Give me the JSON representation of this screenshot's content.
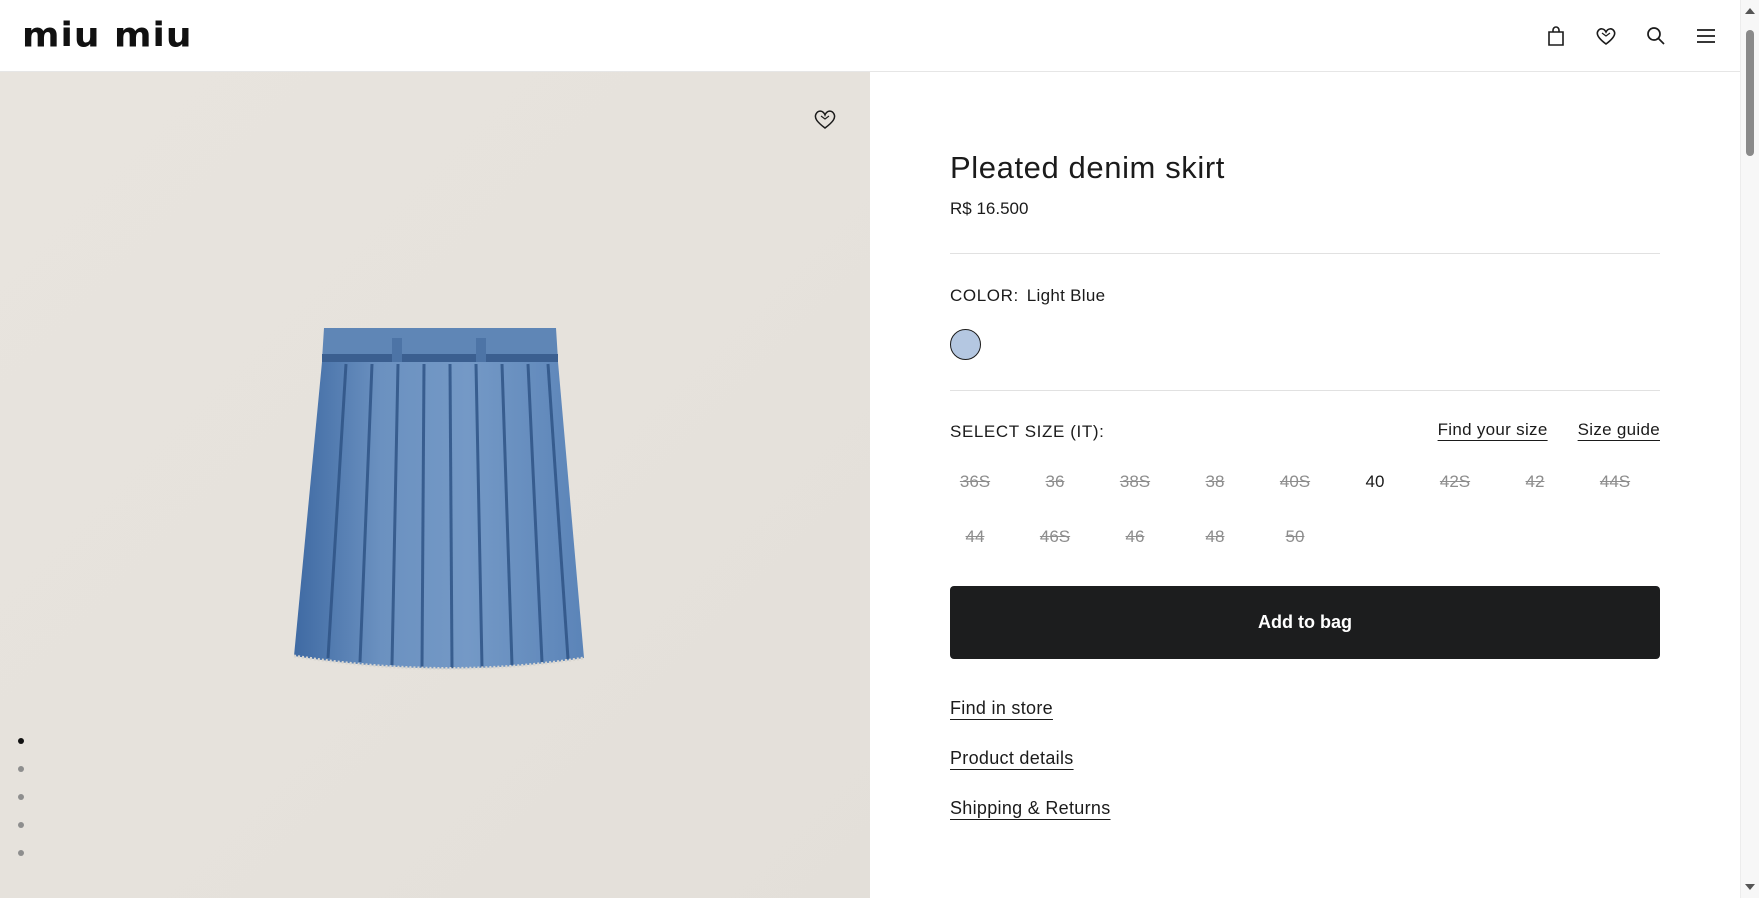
{
  "brand": {
    "logo_text": "miu miu"
  },
  "header": {
    "icons": [
      "shopping-bag-icon",
      "heart-icon",
      "search-icon",
      "menu-icon"
    ]
  },
  "product": {
    "title": "Pleated denim skirt",
    "price": "R$ 16.500",
    "color_label": "COLOR:",
    "color_value": "Light Blue",
    "swatch_color": "#b4c7e1",
    "size_label": "SELECT SIZE (IT):",
    "find_your_size": "Find your size",
    "size_guide": "Size guide",
    "sizes": [
      {
        "label": "36S",
        "available": false
      },
      {
        "label": "36",
        "available": false
      },
      {
        "label": "38S",
        "available": false
      },
      {
        "label": "38",
        "available": false
      },
      {
        "label": "40S",
        "available": false
      },
      {
        "label": "40",
        "available": true
      },
      {
        "label": "42S",
        "available": false
      },
      {
        "label": "42",
        "available": false
      },
      {
        "label": "44S",
        "available": false
      },
      {
        "label": "44",
        "available": false
      },
      {
        "label": "46S",
        "available": false
      },
      {
        "label": "46",
        "available": false
      },
      {
        "label": "48",
        "available": false
      },
      {
        "label": "50",
        "available": false
      }
    ],
    "add_to_bag": "Add to bag",
    "find_in_store": "Find in store",
    "product_details": "Product details",
    "shipping_returns": "Shipping & Returns"
  },
  "gallery": {
    "image_count": 5,
    "active_index": 0
  },
  "colors": {
    "button_bg": "#1c1d1e",
    "image_bg": "#e6e2dc",
    "unavailable_text": "#8d8d8d"
  }
}
